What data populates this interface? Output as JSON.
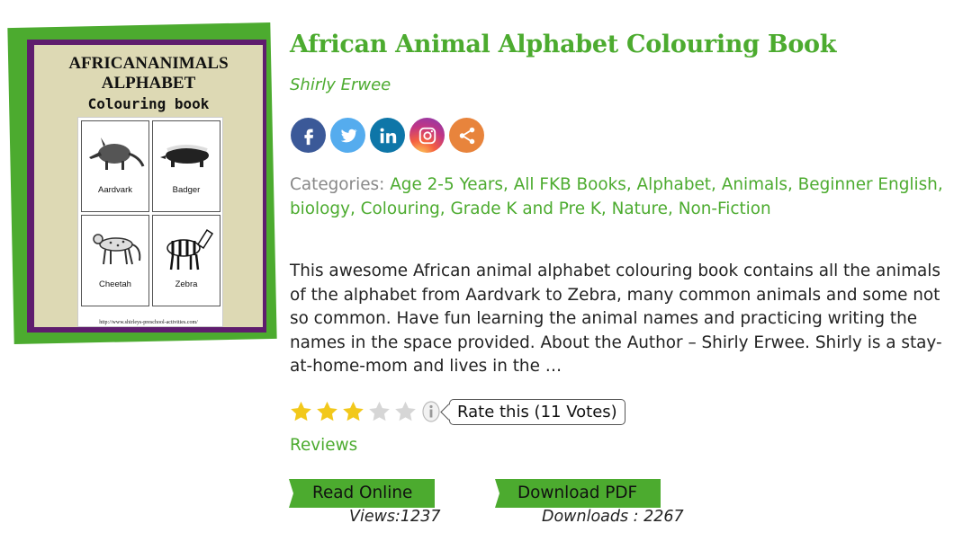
{
  "cover": {
    "title_line1": "AFRICANANIMALS",
    "title_line2": "ALPHABET",
    "subtitle": "Colouring book",
    "cards": [
      {
        "label": "Aardvark"
      },
      {
        "label": "Badger"
      },
      {
        "label": "Cheetah"
      },
      {
        "label": "Zebra"
      }
    ],
    "url": "http://www.shirleys-preschool-activities.com/"
  },
  "book": {
    "title": "African Animal Alphabet Colouring Book",
    "author": "Shirly Erwee"
  },
  "social": [
    {
      "icon": "facebook-icon",
      "glyph": "f",
      "color": "#3b5998"
    },
    {
      "icon": "twitter-icon",
      "glyph": "bird",
      "color": "#55acee"
    },
    {
      "icon": "linkedin-icon",
      "glyph": "in",
      "color": "#0e76a8"
    },
    {
      "icon": "instagram-icon",
      "glyph": "cam",
      "color": "#c13584"
    },
    {
      "icon": "share-icon",
      "glyph": "share",
      "color": "#e8843c"
    }
  ],
  "categories": {
    "label": "Categories:",
    "items": [
      "Age 2-5 Years",
      "All FKB Books",
      "Alphabet",
      "Animals",
      "Beginner English",
      "biology",
      "Colouring",
      "Grade K and Pre K",
      "Nature",
      "Non-Fiction"
    ]
  },
  "description": "This awesome African animal alphabet colouring book contains all the animals of the alphabet from Aardvark to Zebra, many common animals and some not so common. Have fun learning the animal names and practicing writing the names in the space provided. About the Author – Shirly Erwee. Shirly is a stay-at-home-mom and lives in the …",
  "rating": {
    "stars_filled": 3,
    "stars_total": 5,
    "tooltip": "Rate this (11 Votes)",
    "star_color": "#f2c81b",
    "star_empty_color": "#d6d6d6"
  },
  "reviews_label": "Reviews",
  "actions": {
    "read_label": "Read Online",
    "download_label": "Download PDF",
    "views": "Views:1237",
    "downloads": "Downloads : 2267"
  },
  "colors": {
    "accent": "#4cab2f",
    "cover_purple": "#5f1d6e"
  }
}
